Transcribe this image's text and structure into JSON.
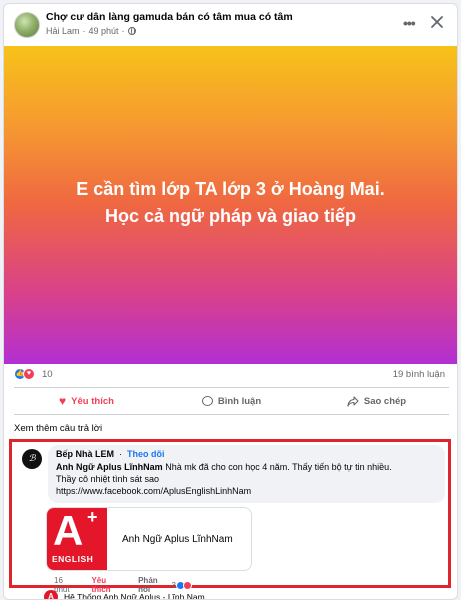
{
  "post": {
    "group_name": "Chợ cư dân làng gamuda bán có tâm mua có tâm",
    "author": "Hải Lam",
    "time": "49 phút",
    "dot_sep": "·",
    "banner_text": "E cần tìm lớp TA lớp 3 ở Hoàng Mai. Học cả ngữ pháp và giao tiếp",
    "banner_colors": [
      "#f7c21a",
      "#ef6742",
      "#b22fd3"
    ],
    "icons": {
      "more": "more-dots-icon",
      "close": "close-icon",
      "privacy": "globe-icon"
    }
  },
  "stats": {
    "reaction_count": "10",
    "comment_count": "19 bình luận"
  },
  "actions": {
    "like": "Yêu thích",
    "comment": "Bình luận",
    "share": "Sao chép"
  },
  "more_answers": "Xem thêm câu trả lời",
  "comment": {
    "author": "Bếp Nhà LEM",
    "dot_sep": "·",
    "follow": "Theo dõi",
    "mention": "Anh Ngữ Aplus LĩnhNam",
    "text_rest": "Nhà mk đã cho con học 4 năm. Thấy tiến bộ tự tin nhiều.",
    "line2": "Thầy cô nhiệt tình sát sao",
    "link": "https://www.facebook.com/AplusEnglishLinhNam",
    "preview": {
      "logo_letter": "A",
      "logo_plus": "+",
      "logo_word": "ENGLISH",
      "title": "Anh Ngữ Aplus LĩnhNam"
    },
    "time": "16 phút",
    "like": "Yêu thích",
    "reply": "Phản hồi",
    "reaction_count": "3",
    "highlight_color": "#e0242b"
  },
  "next_reply": {
    "avatar_letter": "A",
    "author": "Hệ Thống Anh Ngữ Aplus - Lĩnh Nam"
  },
  "colors": {
    "accent": "#1877f2",
    "love": "#f33e58"
  }
}
